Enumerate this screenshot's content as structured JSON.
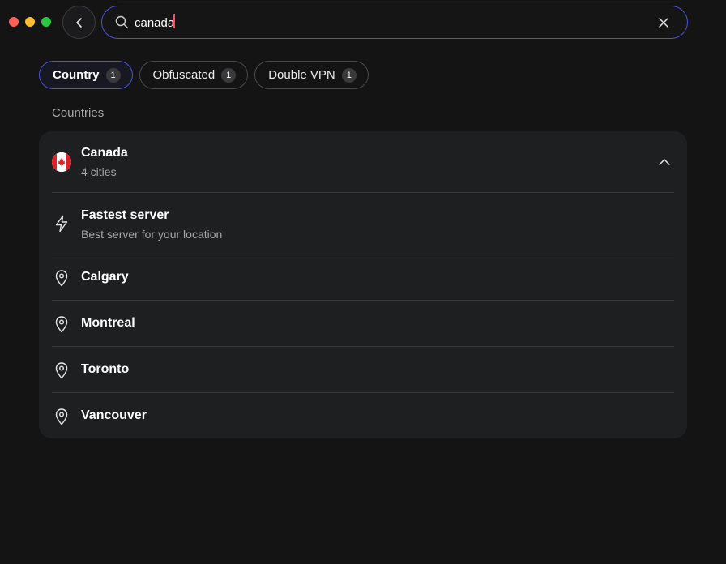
{
  "search": {
    "value": "canada",
    "placeholder": ""
  },
  "filters": [
    {
      "label": "Country",
      "count": "1",
      "active": true
    },
    {
      "label": "Obfuscated",
      "count": "1",
      "active": false
    },
    {
      "label": "Double VPN",
      "count": "1",
      "active": false
    }
  ],
  "section_title": "Countries",
  "country": {
    "name": "Canada",
    "subtitle": "4 cities",
    "flag": "canada-flag"
  },
  "fastest": {
    "title": "Fastest server",
    "subtitle": "Best server for your location",
    "icon": "lightning-icon"
  },
  "cities": [
    {
      "name": "Calgary",
      "icon": "location-pin-icon"
    },
    {
      "name": "Montreal",
      "icon": "location-pin-icon"
    },
    {
      "name": "Toronto",
      "icon": "location-pin-icon"
    },
    {
      "name": "Vancouver",
      "icon": "location-pin-icon"
    }
  ],
  "colors": {
    "background": "#141414",
    "card": "#1e1f21",
    "accent": "#4a55d8",
    "caret": "#ff4d5a",
    "muted_text": "#a7a7aa"
  }
}
